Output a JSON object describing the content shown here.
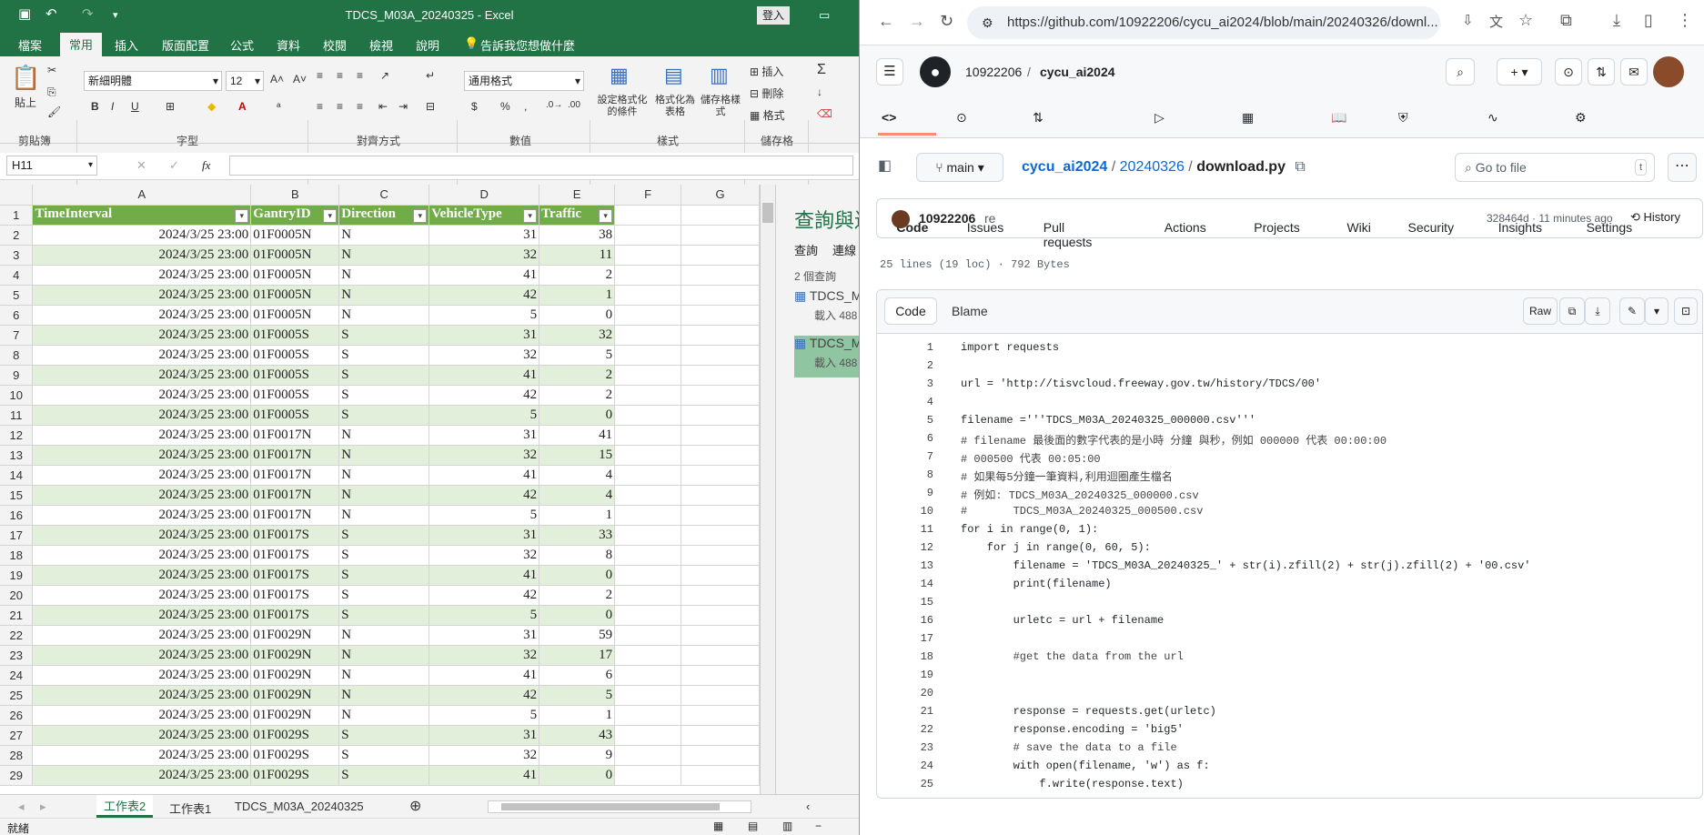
{
  "excel": {
    "title": "TDCS_M03A_20240325 - Excel",
    "login_label": "登入",
    "tabs": [
      "檔案",
      "常用",
      "插入",
      "版面配置",
      "公式",
      "資料",
      "校閱",
      "檢視",
      "說明",
      "告訴我您想做什麼"
    ],
    "active_tab": "常用",
    "ribbon": {
      "paste_label": "貼上",
      "clipboard_label": "剪貼簿",
      "font_name": "新細明體",
      "font_size": "12",
      "font_label": "字型",
      "align_label": "對齊方式",
      "number_format": "通用格式",
      "number_label": "數值",
      "cond_format": "設定格式化的條件",
      "format_table": "格式化為表格",
      "cell_styles": "儲存格樣式",
      "styles_label": "樣式",
      "insert_label": "插入",
      "delete_label": "刪除",
      "format_label": "格式",
      "cells_label": "儲存格"
    },
    "name_box": "H11",
    "fx": "fx",
    "columns": [
      "A",
      "B",
      "C",
      "D",
      "E",
      "F",
      "G"
    ],
    "headers": [
      "TimeInterval",
      "GantryID",
      "Direction",
      "VehicleType",
      "Traffic"
    ],
    "rows": [
      [
        "2024/3/25 23:00",
        "01F0005N",
        "N",
        "31",
        "38"
      ],
      [
        "2024/3/25 23:00",
        "01F0005N",
        "N",
        "32",
        "11"
      ],
      [
        "2024/3/25 23:00",
        "01F0005N",
        "N",
        "41",
        "2"
      ],
      [
        "2024/3/25 23:00",
        "01F0005N",
        "N",
        "42",
        "1"
      ],
      [
        "2024/3/25 23:00",
        "01F0005N",
        "N",
        "5",
        "0"
      ],
      [
        "2024/3/25 23:00",
        "01F0005S",
        "S",
        "31",
        "32"
      ],
      [
        "2024/3/25 23:00",
        "01F0005S",
        "S",
        "32",
        "5"
      ],
      [
        "2024/3/25 23:00",
        "01F0005S",
        "S",
        "41",
        "2"
      ],
      [
        "2024/3/25 23:00",
        "01F0005S",
        "S",
        "42",
        "2"
      ],
      [
        "2024/3/25 23:00",
        "01F0005S",
        "S",
        "5",
        "0"
      ],
      [
        "2024/3/25 23:00",
        "01F0017N",
        "N",
        "31",
        "41"
      ],
      [
        "2024/3/25 23:00",
        "01F0017N",
        "N",
        "32",
        "15"
      ],
      [
        "2024/3/25 23:00",
        "01F0017N",
        "N",
        "41",
        "4"
      ],
      [
        "2024/3/25 23:00",
        "01F0017N",
        "N",
        "42",
        "4"
      ],
      [
        "2024/3/25 23:00",
        "01F0017N",
        "N",
        "5",
        "1"
      ],
      [
        "2024/3/25 23:00",
        "01F0017S",
        "S",
        "31",
        "33"
      ],
      [
        "2024/3/25 23:00",
        "01F0017S",
        "S",
        "32",
        "8"
      ],
      [
        "2024/3/25 23:00",
        "01F0017S",
        "S",
        "41",
        "0"
      ],
      [
        "2024/3/25 23:00",
        "01F0017S",
        "S",
        "42",
        "2"
      ],
      [
        "2024/3/25 23:00",
        "01F0017S",
        "S",
        "5",
        "0"
      ],
      [
        "2024/3/25 23:00",
        "01F0029N",
        "N",
        "31",
        "59"
      ],
      [
        "2024/3/25 23:00",
        "01F0029N",
        "N",
        "32",
        "17"
      ],
      [
        "2024/3/25 23:00",
        "01F0029N",
        "N",
        "41",
        "6"
      ],
      [
        "2024/3/25 23:00",
        "01F0029N",
        "N",
        "42",
        "5"
      ],
      [
        "2024/3/25 23:00",
        "01F0029N",
        "N",
        "5",
        "1"
      ],
      [
        "2024/3/25 23:00",
        "01F0029S",
        "S",
        "31",
        "43"
      ],
      [
        "2024/3/25 23:00",
        "01F0029S",
        "S",
        "32",
        "9"
      ],
      [
        "2024/3/25 23:00",
        "01F0029S",
        "S",
        "41",
        "0"
      ]
    ],
    "query_panel": {
      "title": "查詢與連",
      "tab_query": "查詢",
      "tab_conn": "連線",
      "count": "2 個查詢",
      "items": [
        {
          "name": "TDCS_M",
          "sub": "載入 488"
        },
        {
          "name": "TDCS_M",
          "sub": "載入 488"
        }
      ]
    },
    "sheets": [
      "工作表2",
      "工作表1",
      "TDCS_M03A_20240325"
    ],
    "active_sheet": "工作表2",
    "status": "就緒",
    "colors": {
      "green": "#217346",
      "header_green": "#70ad47",
      "band": "#e2efda"
    }
  },
  "browser": {
    "url": "https://github.com/10922206/cycu_ai2024/blob/main/20240326/downl...",
    "owner": "10922206",
    "repo": "cycu_ai2024",
    "nav": [
      "Code",
      "Issues",
      "Pull requests",
      "Actions",
      "Projects",
      "Wiki",
      "Security",
      "Insights",
      "Settings"
    ],
    "branch": "main",
    "breadcrumb": {
      "repo": "cycu_ai2024",
      "folder": "20240326",
      "file": "download.py"
    },
    "goto_placeholder": "Go to file",
    "goto_key": "t",
    "commit": {
      "author": "10922206",
      "message": "re",
      "hash_time": "328464d · 11 minutes ago",
      "history": "History"
    },
    "file_info": "25 lines (19 loc) · 792 Bytes",
    "code_tab": "Code",
    "blame_tab": "Blame",
    "raw_label": "Raw",
    "lines": [
      "import requests",
      "",
      "url = 'http://tisvcloud.freeway.gov.tw/history/TDCS/00'",
      "",
      "filename ='''TDCS_M03A_20240325_000000.csv'''",
      "# filename 最後面的數字代表的是小時 分鐘 與秒，例如 000000 代表 00:00:00",
      "# 000500 代表 00:05:00",
      "# 如果每5分鐘一筆資料,利用迴圈產生檔名",
      "# 例如: TDCS_M03A_20240325_000000.csv",
      "#       TDCS_M03A_20240325_000500.csv",
      "for i in range(0, 1):",
      "    for j in range(0, 60, 5):",
      "        filename = 'TDCS_M03A_20240325_' + str(i).zfill(2) + str(j).zfill(2) + '00.csv'",
      "        print(filename)",
      "",
      "        urletc = url + filename",
      "",
      "        #get the data from the url",
      "",
      "",
      "        response = requests.get(urletc)",
      "        response.encoding = 'big5'",
      "        # save the data to a file",
      "        with open(filename, 'w') as f:",
      "            f.write(response.text)"
    ]
  }
}
